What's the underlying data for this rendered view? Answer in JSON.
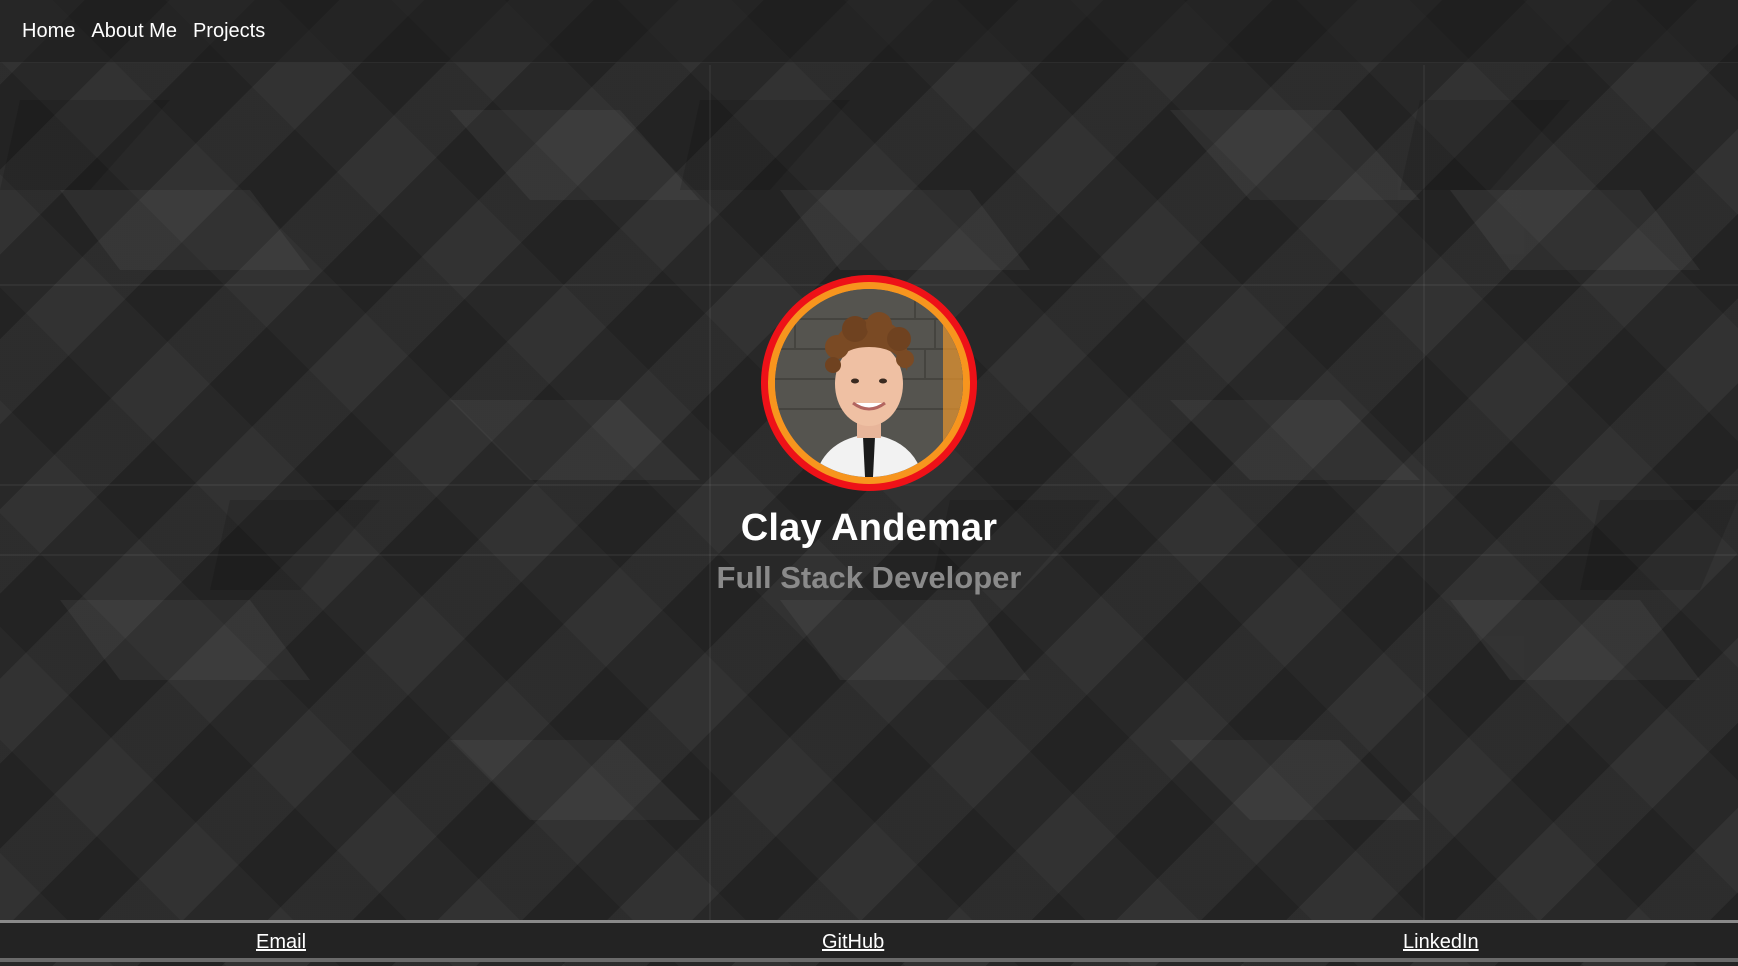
{
  "nav": {
    "items": [
      {
        "label": "Home"
      },
      {
        "label": "About Me"
      },
      {
        "label": "Projects"
      }
    ]
  },
  "hero": {
    "name": "Clay Andemar",
    "title": "Full Stack Developer",
    "avatar_ring_outer_color": "#ee1118",
    "avatar_ring_inner_color": "#f7951e"
  },
  "footer": {
    "links": [
      {
        "label": "Email"
      },
      {
        "label": "GitHub"
      },
      {
        "label": "LinkedIn"
      }
    ]
  },
  "colors": {
    "background": "#262626",
    "subtitle": "#8a8a8a"
  }
}
